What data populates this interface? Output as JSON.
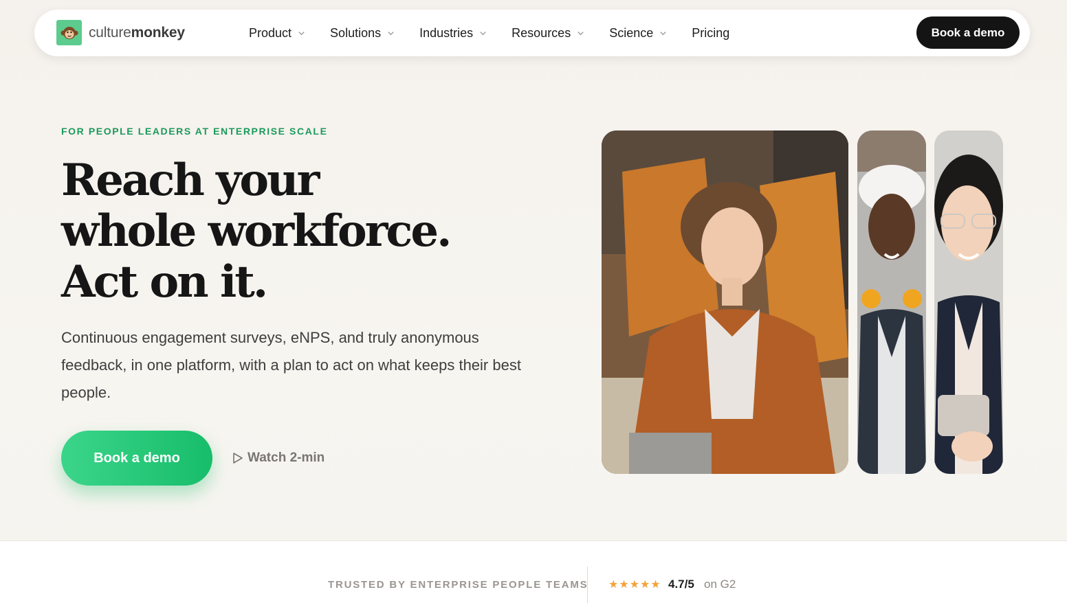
{
  "brand": {
    "name_part1": "culture",
    "name_part2": "monkey",
    "logo_icon": "monkey-face-icon",
    "accent_color": "#1ebd6b"
  },
  "nav": {
    "items": [
      {
        "label": "Product",
        "has_dropdown": true
      },
      {
        "label": "Solutions",
        "has_dropdown": true
      },
      {
        "label": "Industries",
        "has_dropdown": true
      },
      {
        "label": "Resources",
        "has_dropdown": true
      },
      {
        "label": "Science",
        "has_dropdown": true
      },
      {
        "label": "Pricing",
        "has_dropdown": false
      }
    ],
    "cta_label": "Book a demo"
  },
  "hero": {
    "eyebrow": "FOR PEOPLE LEADERS AT ENTERPRISE SCALE",
    "headline_lines": [
      "Reach your",
      "whole workforce.",
      "Act on it."
    ],
    "subtext": "Continuous engagement surveys, eNPS, and truly anonymous feedback, in one platform, with a plan to act on what keeps their best people.",
    "primary_cta": "Book a demo",
    "secondary_cta": "Watch 2-min",
    "secondary_icon": "play-outline-icon"
  },
  "trust": {
    "label": "TRUSTED BY ENTERPRISE PEOPLE TEAMS",
    "stars": "★★★★★",
    "rating": "4.7/5",
    "rating_suffix": "on G2",
    "star_color": "#f2a33a"
  }
}
